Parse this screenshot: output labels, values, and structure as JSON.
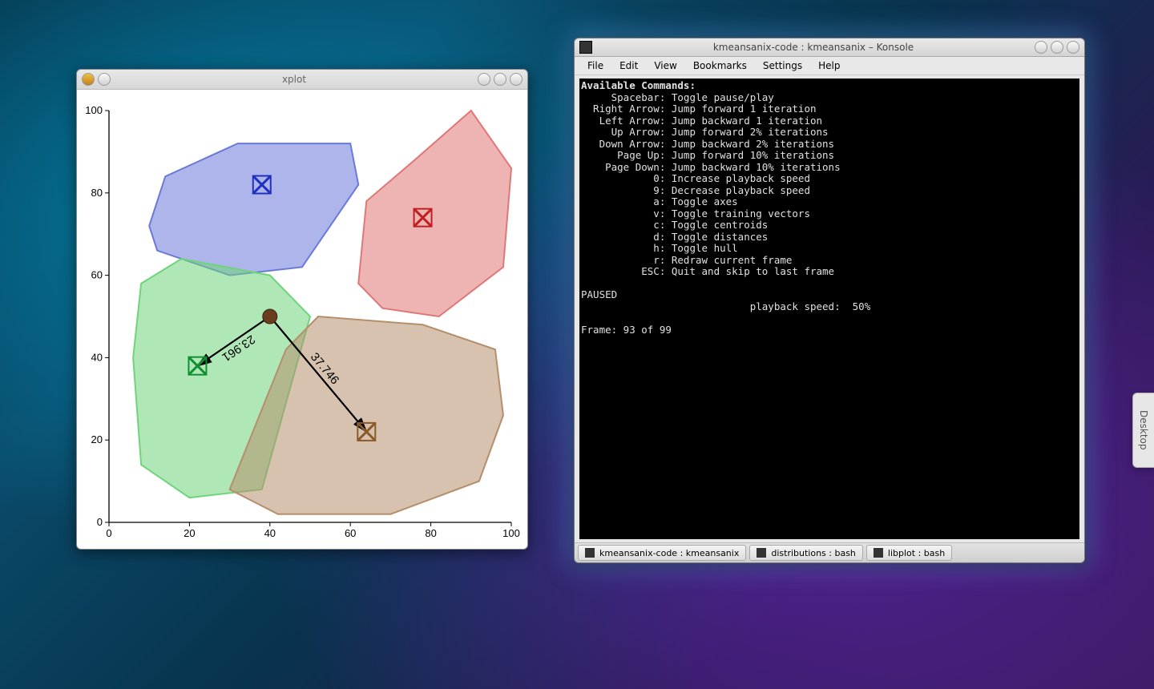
{
  "desktop_tab_label": "Desktop",
  "xplot": {
    "title": "xplot"
  },
  "konsole": {
    "title": "kmeansanix-code : kmeansanix – Konsole",
    "menu": [
      "File",
      "Edit",
      "View",
      "Bookmarks",
      "Settings",
      "Help"
    ],
    "tabs": [
      {
        "label": "kmeansanix-code : kmeansanix"
      },
      {
        "label": "distributions : bash"
      },
      {
        "label": "libplot : bash"
      }
    ],
    "term": {
      "header": "Available Commands:",
      "commands": [
        {
          "key": "Spacebar",
          "desc": "Toggle pause/play"
        },
        {
          "key": "Right Arrow",
          "desc": "Jump forward 1 iteration"
        },
        {
          "key": "Left Arrow",
          "desc": "Jump backward 1 iteration"
        },
        {
          "key": "Up Arrow",
          "desc": "Jump forward 2% iterations"
        },
        {
          "key": "Down Arrow",
          "desc": "Jump backward 2% iterations"
        },
        {
          "key": "Page Up",
          "desc": "Jump forward 10% iterations"
        },
        {
          "key": "Page Down",
          "desc": "Jump backward 10% iterations"
        },
        {
          "key": "0",
          "desc": "Increase playback speed"
        },
        {
          "key": "9",
          "desc": "Decrease playback speed"
        },
        {
          "key": "a",
          "desc": "Toggle axes"
        },
        {
          "key": "v",
          "desc": "Toggle training vectors"
        },
        {
          "key": "c",
          "desc": "Toggle centroids"
        },
        {
          "key": "d",
          "desc": "Toggle distances"
        },
        {
          "key": "h",
          "desc": "Toggle hull"
        },
        {
          "key": "r",
          "desc": "Redraw current frame"
        },
        {
          "key": "ESC",
          "desc": "Quit and skip to last frame"
        }
      ],
      "status": "PAUSED",
      "speed_label": "playback speed:",
      "speed_value": "50%",
      "frame_label": "Frame: 93 of 99"
    }
  },
  "chart_data": {
    "type": "scatter",
    "title": "",
    "xlabel": "",
    "ylabel": "",
    "xlim": [
      0,
      100
    ],
    "ylim": [
      0,
      100
    ],
    "xticks": [
      0,
      20,
      40,
      60,
      80,
      100
    ],
    "yticks": [
      0,
      20,
      40,
      60,
      80,
      100
    ],
    "clusters": [
      {
        "name": "blue",
        "color": "#6a79d8",
        "centroid": {
          "x": 38,
          "y": 82
        },
        "hull": [
          {
            "x": 10,
            "y": 72
          },
          {
            "x": 14,
            "y": 84
          },
          {
            "x": 32,
            "y": 92
          },
          {
            "x": 60,
            "y": 92
          },
          {
            "x": 62,
            "y": 82
          },
          {
            "x": 48,
            "y": 62
          },
          {
            "x": 30,
            "y": 60
          },
          {
            "x": 12,
            "y": 66
          }
        ]
      },
      {
        "name": "red",
        "color": "#e07777",
        "centroid": {
          "x": 78,
          "y": 74
        },
        "hull": [
          {
            "x": 62,
            "y": 58
          },
          {
            "x": 64,
            "y": 78
          },
          {
            "x": 76,
            "y": 88
          },
          {
            "x": 90,
            "y": 100
          },
          {
            "x": 100,
            "y": 86
          },
          {
            "x": 98,
            "y": 62
          },
          {
            "x": 82,
            "y": 50
          },
          {
            "x": 68,
            "y": 52
          }
        ]
      },
      {
        "name": "green",
        "color": "#6fd47a",
        "centroid": {
          "x": 22,
          "y": 38
        },
        "hull": [
          {
            "x": 8,
            "y": 14
          },
          {
            "x": 6,
            "y": 40
          },
          {
            "x": 8,
            "y": 58
          },
          {
            "x": 18,
            "y": 64
          },
          {
            "x": 40,
            "y": 60
          },
          {
            "x": 50,
            "y": 50
          },
          {
            "x": 42,
            "y": 22
          },
          {
            "x": 38,
            "y": 8
          },
          {
            "x": 20,
            "y": 6
          }
        ]
      },
      {
        "name": "brown",
        "color": "#b58f6c",
        "centroid": {
          "x": 64,
          "y": 22
        },
        "hull": [
          {
            "x": 30,
            "y": 8
          },
          {
            "x": 44,
            "y": 42
          },
          {
            "x": 52,
            "y": 50
          },
          {
            "x": 78,
            "y": 48
          },
          {
            "x": 96,
            "y": 42
          },
          {
            "x": 98,
            "y": 26
          },
          {
            "x": 92,
            "y": 10
          },
          {
            "x": 70,
            "y": 2
          },
          {
            "x": 42,
            "y": 2
          }
        ]
      }
    ],
    "query_point": {
      "x": 40,
      "y": 50,
      "color": "#6b3d1f"
    },
    "distances": [
      {
        "to": "green",
        "value": 23.961,
        "from": {
          "x": 40,
          "y": 50
        },
        "target": {
          "x": 22,
          "y": 38
        }
      },
      {
        "to": "brown",
        "value": 37.746,
        "from": {
          "x": 40,
          "y": 50
        },
        "target": {
          "x": 64,
          "y": 22
        }
      }
    ]
  }
}
